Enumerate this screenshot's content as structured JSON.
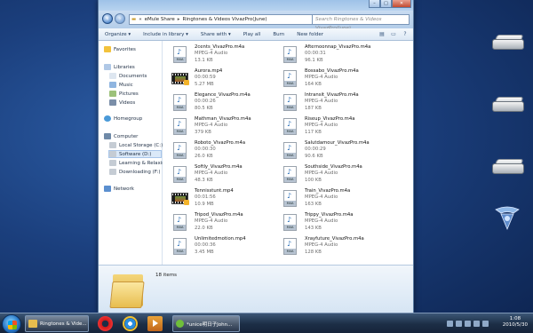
{
  "window": {
    "address": [
      "eMule Share",
      "Ringtones & Videos VivazPro(June)"
    ],
    "address_prefix": "«",
    "search_placeholder": "Search Ringtones & Videos VivazPro(June)",
    "buttons": {
      "minimize": "–",
      "maximize": "□",
      "close": "✕"
    }
  },
  "toolbar": {
    "items": [
      "Organize ▾",
      "Include in library ▾",
      "Share with ▾",
      "Play all",
      "Burn",
      "New folder"
    ]
  },
  "nav": {
    "favorites": "Favorites",
    "libraries": "Libraries",
    "documents": "Documents",
    "music": "Music",
    "pictures": "Pictures",
    "videos": "Videos",
    "homegroup": "Homegroup",
    "computer": "Computer",
    "local_storage": "Local Storage (C:)",
    "software": "Software (D:)",
    "learning": "Learning & Relaxing",
    "downloading": "Downloading (F:)",
    "network": "Network"
  },
  "files": [
    {
      "name": "2cents_VivazPro.m4a",
      "l2": "MPEG-4 Audio",
      "l3": "13.1 KB",
      "kind": "audio"
    },
    {
      "name": "Afternoonnap_VivazPro.m4a",
      "l2": "00:00:31",
      "l3": "96.1 KB",
      "kind": "audio"
    },
    {
      "name": "Aurora.mp4",
      "l2": "00:00:59",
      "l3": "5.27 MB",
      "kind": "video"
    },
    {
      "name": "Bossabo_VivazPro.m4a",
      "l2": "MPEG-4 Audio",
      "l3": "164 KB",
      "kind": "audio"
    },
    {
      "name": "Elegance_VivazPro.m4a",
      "l2": "00:00:26",
      "l3": "80.5 KB",
      "kind": "audio"
    },
    {
      "name": "Intransit_VivazPro.m4a",
      "l2": "MPEG-4 Audio",
      "l3": "187 KB",
      "kind": "audio"
    },
    {
      "name": "Mathman_VivazPro.m4a",
      "l2": "MPEG-4 Audio",
      "l3": "379 KB",
      "kind": "audio"
    },
    {
      "name": "Riseup_VivazPro.m4a",
      "l2": "MPEG-4 Audio",
      "l3": "117 KB",
      "kind": "audio"
    },
    {
      "name": "Roboto_VivazPro.m4a",
      "l2": "00:00:30",
      "l3": "26.0 KB",
      "kind": "audio"
    },
    {
      "name": "Salutdamour_VivazPro.m4a",
      "l2": "00:00:29",
      "l3": "90.6 KB",
      "kind": "audio"
    },
    {
      "name": "Softly_VivazPro.m4a",
      "l2": "MPEG-4 Audio",
      "l3": "48.3 KB",
      "kind": "audio"
    },
    {
      "name": "Southside_VivazPro.m4a",
      "l2": "MPEG-4 Audio",
      "l3": "100 KB",
      "kind": "audio"
    },
    {
      "name": "Tennisstunt.mp4",
      "l2": "00:01:56",
      "l3": "10.9 MB",
      "kind": "video"
    },
    {
      "name": "Train_VivazPro.m4a",
      "l2": "MPEG-4 Audio",
      "l3": "163 KB",
      "kind": "audio"
    },
    {
      "name": "Tripod_VivazPro.m4a",
      "l2": "MPEG-4 Audio",
      "l3": "22.0 KB",
      "kind": "audio"
    },
    {
      "name": "Trippy_VivazPro.m4a",
      "l2": "MPEG-4 Audio",
      "l3": "143 KB",
      "kind": "audio"
    },
    {
      "name": "Unlimitedmotion.mp4",
      "l2": "00:00:36",
      "l3": "3.45 MB",
      "kind": "audio"
    },
    {
      "name": "Xrayfuture_VivazPro.m4a",
      "l2": "MPEG-4 Audio",
      "l3": "128 KB",
      "kind": "audio"
    }
  ],
  "file_badge": "M4A",
  "details": {
    "count": "18 items"
  },
  "taskbar": {
    "explorer_label": "Ringtones & Vide...",
    "chat_label": "*unice明日子John...",
    "time": "1:08",
    "date": "2010/5/30"
  },
  "colors": {
    "accent": "#2a6fb8",
    "taskbar": "#1c2e46"
  }
}
